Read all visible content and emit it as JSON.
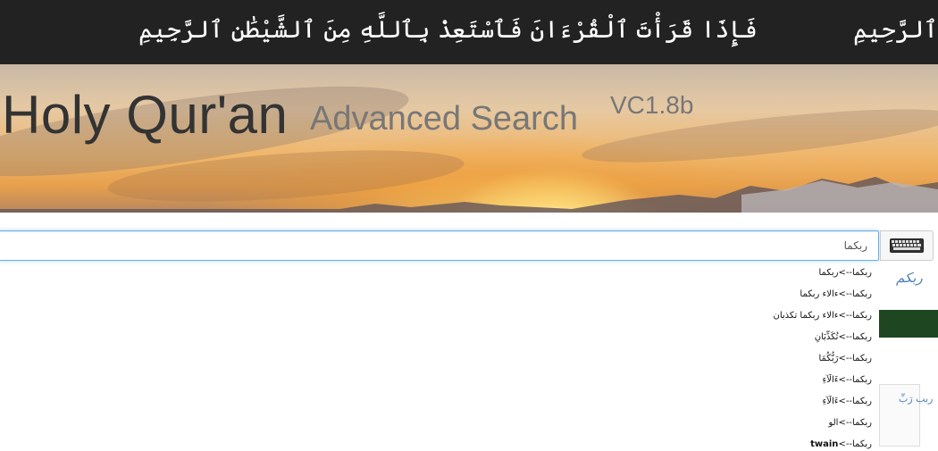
{
  "header": {
    "ayah_text": "فَإِذَا قَرَأْتَ ٱلْقُرْءَانَ فَٱسْتَعِذْ بِٱللَّهِ مِنَ ٱلشَّيْطَٰنِ ٱلرَّجِيمِ",
    "basmala_text": "۞ بِسْمِ ٱللَّهِ ٱلرَّحْمَٰنِ ٱلرَّحِيمِ"
  },
  "banner": {
    "title": "Holy Qur'an",
    "subtitle": "Advanced Search",
    "version": "VC1.8b"
  },
  "search": {
    "value": "ربكما",
    "keyboard_icon": "keyboard-icon"
  },
  "sidebar": {
    "word": "ربكم",
    "panel_label": "ربب رَبِّ"
  },
  "suggestions": [
    {
      "prefix": "ربكما-->",
      "text": "ربكما"
    },
    {
      "prefix": "ربكما-->",
      "text": "ءالاء ربكما"
    },
    {
      "prefix": "ربكما-->",
      "text": "ءالاء ربكما تكذبان"
    },
    {
      "prefix": "ربكما-->",
      "text": "تُكَذِّبَانِ"
    },
    {
      "prefix": "ربكما-->",
      "text": "رَبُّكُمَا"
    },
    {
      "prefix": "ربكما-->",
      "text": "ءَالَآءِ"
    },
    {
      "prefix": "ربكما-->",
      "text": "ءَالَآءِ"
    },
    {
      "prefix": "ربكما-->",
      "text": "الو"
    },
    {
      "prefix": "ربكما-->",
      "text": "twain"
    }
  ],
  "colors": {
    "topbar_bg": "#222222",
    "title": "#333333",
    "subtitle": "#777777",
    "input_focus": "#66afe9",
    "link": "#4f7fb6",
    "green_panel": "#1e4620"
  }
}
